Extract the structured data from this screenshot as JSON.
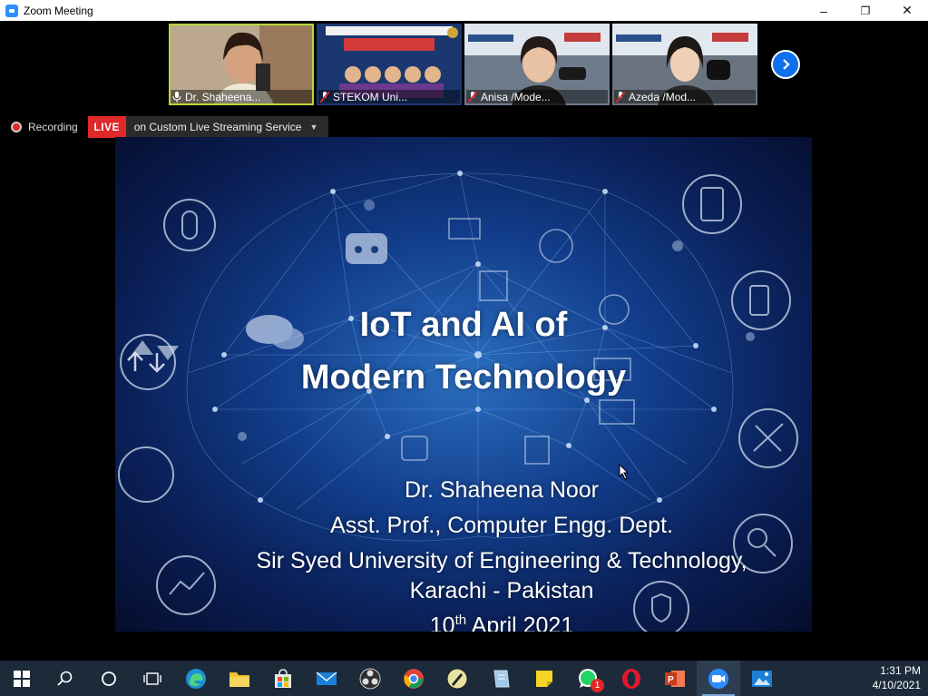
{
  "window": {
    "title": "Zoom Meeting",
    "minimize": "–",
    "restore": "❐",
    "close": "✕"
  },
  "participants": [
    {
      "name": "Dr. Shaheena...",
      "muted": false,
      "tile_color": "#b9a58a"
    },
    {
      "name": "STEKOM Uni...",
      "muted": true,
      "tile_color": "#1b3770"
    },
    {
      "name": "Anisa /Mode...",
      "muted": true,
      "tile_color": "#5d6a7a"
    },
    {
      "name": "Azeda /Mod...",
      "muted": true,
      "tile_color": "#5e6772"
    }
  ],
  "recording": {
    "label": "Recording",
    "live_badge": "LIVE",
    "stream_text": "on Custom Live Streaming Service"
  },
  "slide": {
    "title_line1": "IoT and AI of",
    "title_line2": "Modern Technology",
    "presenter": "Dr. Shaheena Noor",
    "position": "Asst. Prof.,  Computer Engg. Dept.",
    "university_line1": "Sir Syed University of Engineering & Technology,",
    "university_line2": "Karachi - Pakistan",
    "date_day": "10",
    "date_suffix": "th",
    "date_rest": " April 2021"
  },
  "taskbar": {
    "icons": [
      "windows-start-icon",
      "search-icon",
      "cortana-icon",
      "task-view-icon",
      "edge-icon",
      "file-explorer-icon",
      "store-icon",
      "mail-icon",
      "obs-icon",
      "chrome-icon",
      "pen-icon",
      "notepad-icon",
      "sticky-notes-icon",
      "whatsapp-icon",
      "opera-icon",
      "powerpoint-icon",
      "zoom-icon",
      "photos-icon"
    ],
    "whatsapp_badge": "1",
    "time": "1:31 PM",
    "date": "4/10/2021"
  }
}
